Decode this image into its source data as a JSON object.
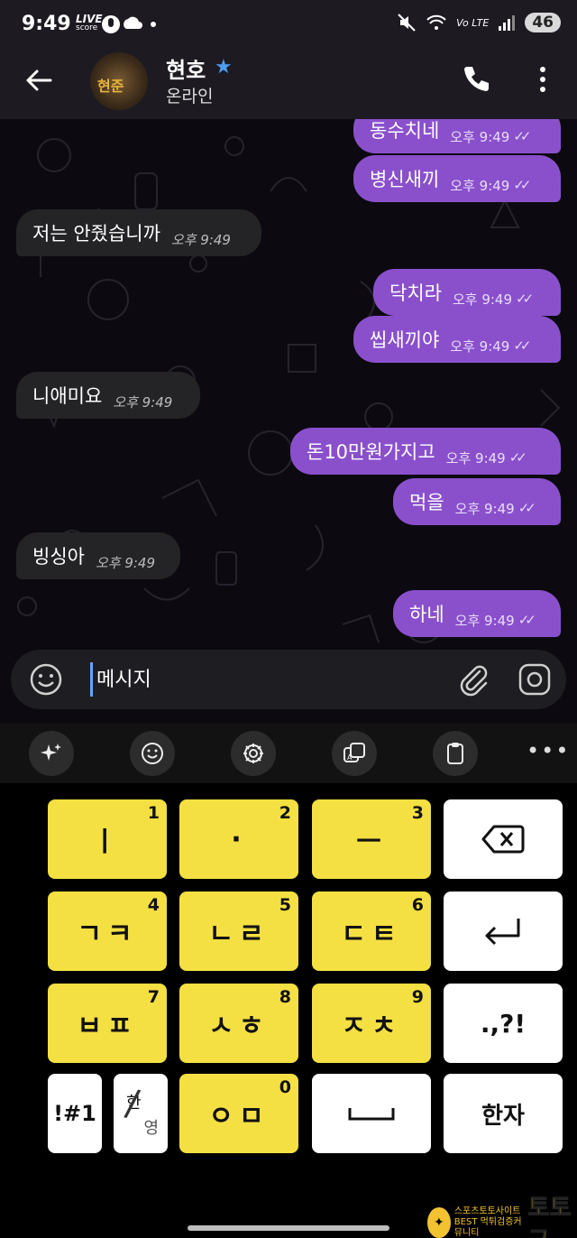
{
  "status_bar": {
    "time": "9:49",
    "live_label": "LIVE",
    "live_sub": "score",
    "network": "Vo LTE",
    "battery": "46"
  },
  "header": {
    "avatar_text": "현준",
    "contact_name": "현호",
    "contact_status": "온라인"
  },
  "messages": [
    {
      "dir": "out",
      "text": "동수치네",
      "time": "오후 9:49"
    },
    {
      "dir": "out",
      "text": "병신새끼",
      "time": "오후 9:49"
    },
    {
      "dir": "in",
      "text": "저는 안줬습니까",
      "time": "오후 9:49"
    },
    {
      "dir": "out",
      "text": "닥치라",
      "time": "오후 9:49"
    },
    {
      "dir": "out",
      "text": "씹새끼야",
      "time": "오후 9:49"
    },
    {
      "dir": "in",
      "text": "니애미요",
      "time": "오후 9:49"
    },
    {
      "dir": "out",
      "text": "돈10만원가지고",
      "time": "오후 9:49"
    },
    {
      "dir": "out",
      "text": "먹을",
      "time": "오후 9:49"
    },
    {
      "dir": "in",
      "text": "빙싱아",
      "time": "오후 9:49"
    },
    {
      "dir": "out",
      "text": "하네",
      "time": "오후 9:49"
    }
  ],
  "input": {
    "placeholder": "메시지"
  },
  "keyboard": {
    "keys": [
      {
        "label": "ㅣ",
        "num": "1"
      },
      {
        "label": "·",
        "num": "2"
      },
      {
        "label": "ㅡ",
        "num": "3"
      },
      {
        "label": "ㄱㅋ",
        "num": "4"
      },
      {
        "label": "ㄴㄹ",
        "num": "5"
      },
      {
        "label": "ㄷㅌ",
        "num": "6"
      },
      {
        "label": "ㅂㅍ",
        "num": "7"
      },
      {
        "label": "ㅅㅎ",
        "num": "8"
      },
      {
        "label": "ㅈㅊ",
        "num": "9"
      },
      {
        "label": "ㅇㅁ",
        "num": "0"
      }
    ],
    "punct_label": ".,?!",
    "symbols_label": "!#1",
    "han_label": "한",
    "young_label": "영",
    "hanja_label": "한자"
  },
  "watermark": {
    "line1": "스포츠토토사이트",
    "line2": "BEST 먹튀검증커뮤니티",
    "brand": "토토군"
  }
}
